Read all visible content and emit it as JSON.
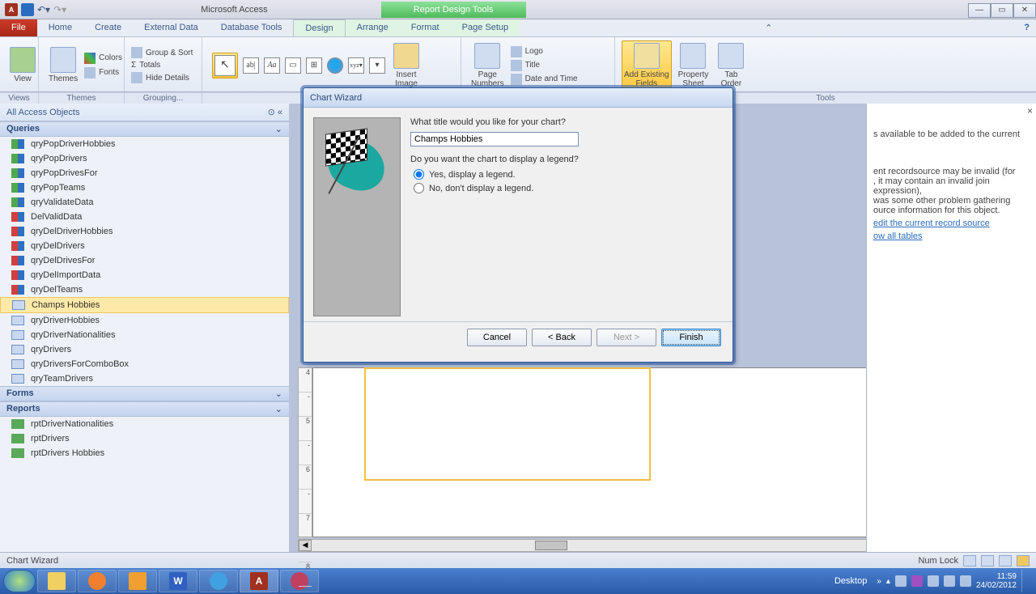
{
  "titlebar": {
    "app": "Microsoft Access",
    "context": "Report Design Tools"
  },
  "win_controls": {
    "min": "—",
    "max": "▭",
    "close": "✕"
  },
  "tabs": {
    "file": "File",
    "home": "Home",
    "create": "Create",
    "external": "External Data",
    "dbtools": "Database Tools",
    "design": "Design",
    "arrange": "Arrange",
    "format": "Format",
    "pagesetup": "Page Setup"
  },
  "ribbon": {
    "view": "View",
    "themes": "Themes",
    "colors": "Colors",
    "fonts": "Fonts",
    "group_sort": "Group & Sort",
    "totals": "Totals",
    "hide_details": "Hide Details",
    "insert_image": "Insert\nImage",
    "page_numbers": "Page\nNumbers",
    "logo": "Logo",
    "title": "Title",
    "datetime": "Date and Time",
    "existing_fields": "Add Existing\nFields",
    "prop_sheet": "Property\nSheet",
    "tab_order": "Tab\nOrder",
    "labels": {
      "views": "Views",
      "themes": "Themes",
      "grouping": "Grouping...",
      "tools": "Tools"
    }
  },
  "nav": {
    "header": "All Access Objects",
    "sections": {
      "queries": "Queries",
      "forms": "Forms",
      "reports": "Reports"
    },
    "queries": [
      {
        "icon": "query",
        "label": "qryPopDriverHobbies"
      },
      {
        "icon": "query",
        "label": "qryPopDrivers"
      },
      {
        "icon": "query",
        "label": "qryPopDrivesFor"
      },
      {
        "icon": "query",
        "label": "qryPopTeams"
      },
      {
        "icon": "query",
        "label": "qryValidateData"
      },
      {
        "icon": "delquery",
        "label": "DelValidData"
      },
      {
        "icon": "delquery",
        "label": "qryDelDriverHobbies"
      },
      {
        "icon": "delquery",
        "label": "qryDelDrivers"
      },
      {
        "icon": "delquery",
        "label": "qryDelDrivesFor"
      },
      {
        "icon": "delquery",
        "label": "qryDelImportData"
      },
      {
        "icon": "delquery",
        "label": "qryDelTeams"
      },
      {
        "icon": "selquery",
        "label": "Champs Hobbies",
        "selected": true
      },
      {
        "icon": "selquery",
        "label": "qryDriverHobbies"
      },
      {
        "icon": "selquery",
        "label": "qryDriverNationalities"
      },
      {
        "icon": "selquery",
        "label": "qryDrivers"
      },
      {
        "icon": "selquery",
        "label": "qryDriversForComboBox"
      },
      {
        "icon": "selquery",
        "label": "qryTeamDrivers"
      }
    ],
    "reports": [
      {
        "label": "rptDriverNationalities"
      },
      {
        "label": "rptDrivers"
      },
      {
        "label": "rptDrivers Hobbies"
      }
    ]
  },
  "fieldlist": {
    "line1": "s available to be added to the current",
    "line2": "ent recordsource may be invalid (for",
    "line3": ", it may contain an invalid join expression),",
    "line4": "was some other problem gathering",
    "line5": "ource information for this object.",
    "link1": "edit the current record source",
    "link2": "ow all tables"
  },
  "dialog": {
    "title": "Chart Wizard",
    "q_title": "What title would you like for your chart?",
    "title_value": "Champs Hobbies",
    "q_legend": "Do you want the chart to display a legend?",
    "opt_yes": "Yes, display a legend.",
    "opt_no": "No, don't display a legend.",
    "buttons": {
      "cancel": "Cancel",
      "back": "< Back",
      "next": "Next >",
      "finish": "Finish"
    }
  },
  "statusbar": {
    "left": "Chart Wizard",
    "numlock": "Num Lock"
  },
  "taskbar": {
    "desktop": "Desktop",
    "time": "11:59",
    "date": "24/02/2012"
  },
  "ruler": [
    "4",
    "-",
    "5",
    "-",
    "6",
    "-",
    "7",
    "-",
    "8"
  ]
}
